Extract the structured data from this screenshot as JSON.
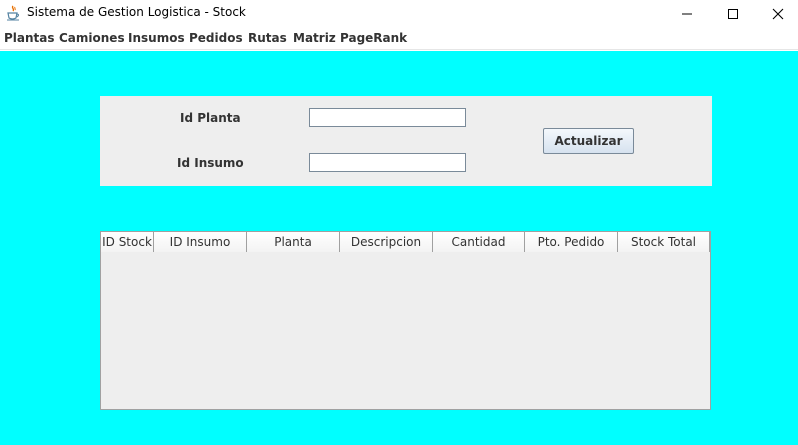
{
  "window": {
    "title": "Sistema de Gestion Logistica - Stock",
    "icon": "java-coffee-icon",
    "controls": [
      "minimize-icon",
      "maximize-icon",
      "close-icon"
    ]
  },
  "menubar": {
    "items": [
      "Plantas",
      "Camiones",
      "Insumos",
      "Pedidos",
      "Rutas",
      "Matriz",
      "PageRank"
    ]
  },
  "form": {
    "id_planta_label": "Id Planta",
    "id_planta_value": "",
    "id_insumo_label": "Id Insumo",
    "id_insumo_value": "",
    "actualizar_label": "Actualizar"
  },
  "table": {
    "columns": [
      "ID Stock",
      "ID Insumo",
      "Planta",
      "Descripcion",
      "Cantidad",
      "Pto. Pedido",
      "Stock Total"
    ],
    "rows": []
  },
  "colors": {
    "background": "#00ffff",
    "panel": "#eeeeee"
  }
}
